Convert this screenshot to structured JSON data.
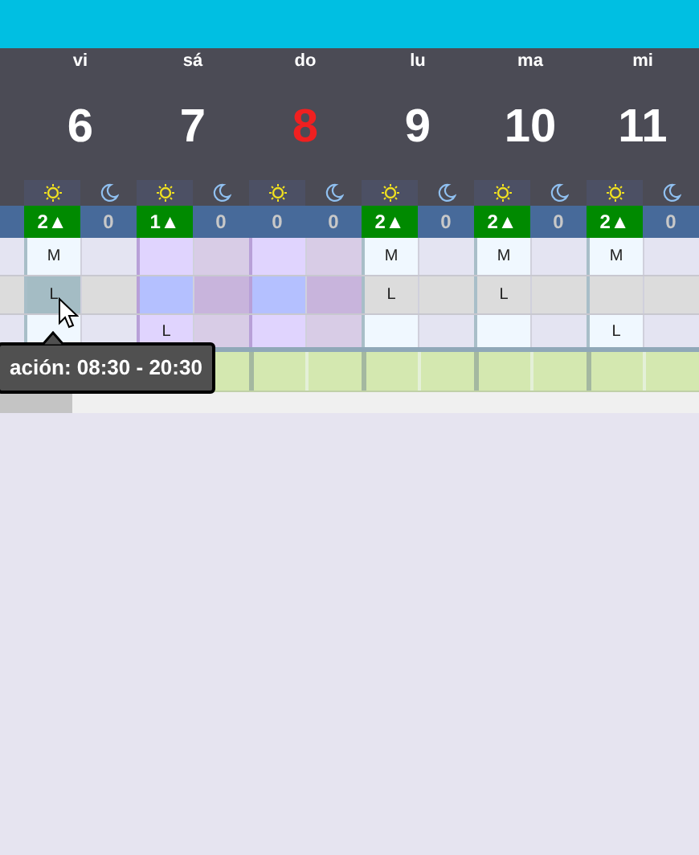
{
  "days": [
    {
      "weekday": "vi",
      "date": "6",
      "kind": "weekday",
      "holiday": false,
      "day_count": "2▲",
      "day_over": true,
      "night_count": "0",
      "night_over": false,
      "cells": [
        {
          "day": "M",
          "hovered": false
        },
        {
          "day": "L",
          "hovered": true
        },
        {
          "hovered": false
        }
      ]
    },
    {
      "weekday": "sá",
      "date": "7",
      "kind": "weekend",
      "holiday": false,
      "day_count": "1▲",
      "day_over": true,
      "night_count": "0",
      "night_over": false,
      "cells": [
        {
          "hovered": false
        },
        {
          "hovered": false
        },
        {
          "day": "L",
          "hovered": false
        }
      ]
    },
    {
      "weekday": "do",
      "date": "8",
      "kind": "weekend",
      "holiday": true,
      "day_count": "0",
      "day_over": false,
      "night_count": "0",
      "night_over": false,
      "cells": [
        {
          "hovered": false
        },
        {
          "hovered": false
        },
        {
          "hovered": false
        }
      ]
    },
    {
      "weekday": "lu",
      "date": "9",
      "kind": "weekday",
      "holiday": false,
      "day_count": "2▲",
      "day_over": true,
      "night_count": "0",
      "night_over": false,
      "cells": [
        {
          "day": "M",
          "hovered": false
        },
        {
          "day": "L",
          "hovered": false
        },
        {
          "hovered": false
        }
      ]
    },
    {
      "weekday": "ma",
      "date": "10",
      "kind": "weekday",
      "holiday": false,
      "day_count": "2▲",
      "day_over": true,
      "night_count": "0",
      "night_over": false,
      "cells": [
        {
          "day": "M",
          "hovered": false
        },
        {
          "day": "L",
          "hovered": false
        },
        {
          "hovered": false
        }
      ]
    },
    {
      "weekday": "mi",
      "date": "11",
      "kind": "weekday",
      "holiday": false,
      "day_count": "2▲",
      "day_over": true,
      "night_count": "0",
      "night_over": false,
      "cells": [
        {
          "day": "M",
          "hovered": false
        },
        {
          "hovered": false
        },
        {
          "day": "L",
          "hovered": false
        }
      ]
    }
  ],
  "tooltip": {
    "text": "ación: 08:30 - 20:30"
  }
}
